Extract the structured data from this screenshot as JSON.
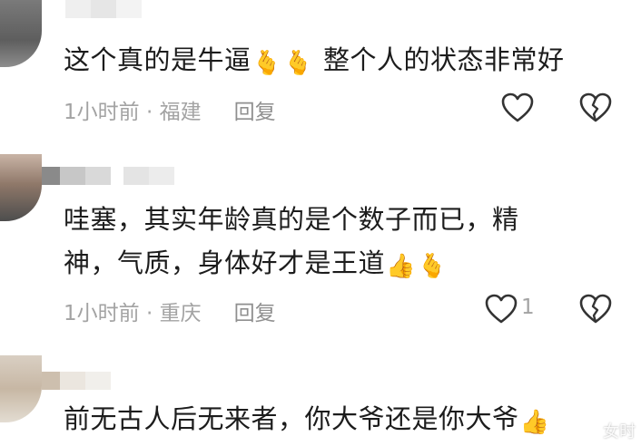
{
  "comments": [
    {
      "text": "这个真的是牛逼",
      "emoji_after": [
        "🫰",
        "🫰"
      ],
      "text_tail": "整个人的状态非常好",
      "time": "1小时前",
      "location": "福建",
      "reply": "回复",
      "likes": ""
    },
    {
      "line1": "哇塞，其实年龄真的是个数子而已，精",
      "line2": "神，气质，身体好才是王道",
      "emoji_after": [
        "👍",
        "🫰"
      ],
      "time": "1小时前",
      "location": "重庆",
      "reply": "回复",
      "likes": "1"
    },
    {
      "text": "前无古人后无来者，你大爷还是你大爷",
      "emoji_after": [
        "👍"
      ]
    }
  ],
  "separator": " · ",
  "icons": {
    "like": "heart-outline-icon",
    "dislike": "broken-heart-icon"
  },
  "watermark": "女时"
}
